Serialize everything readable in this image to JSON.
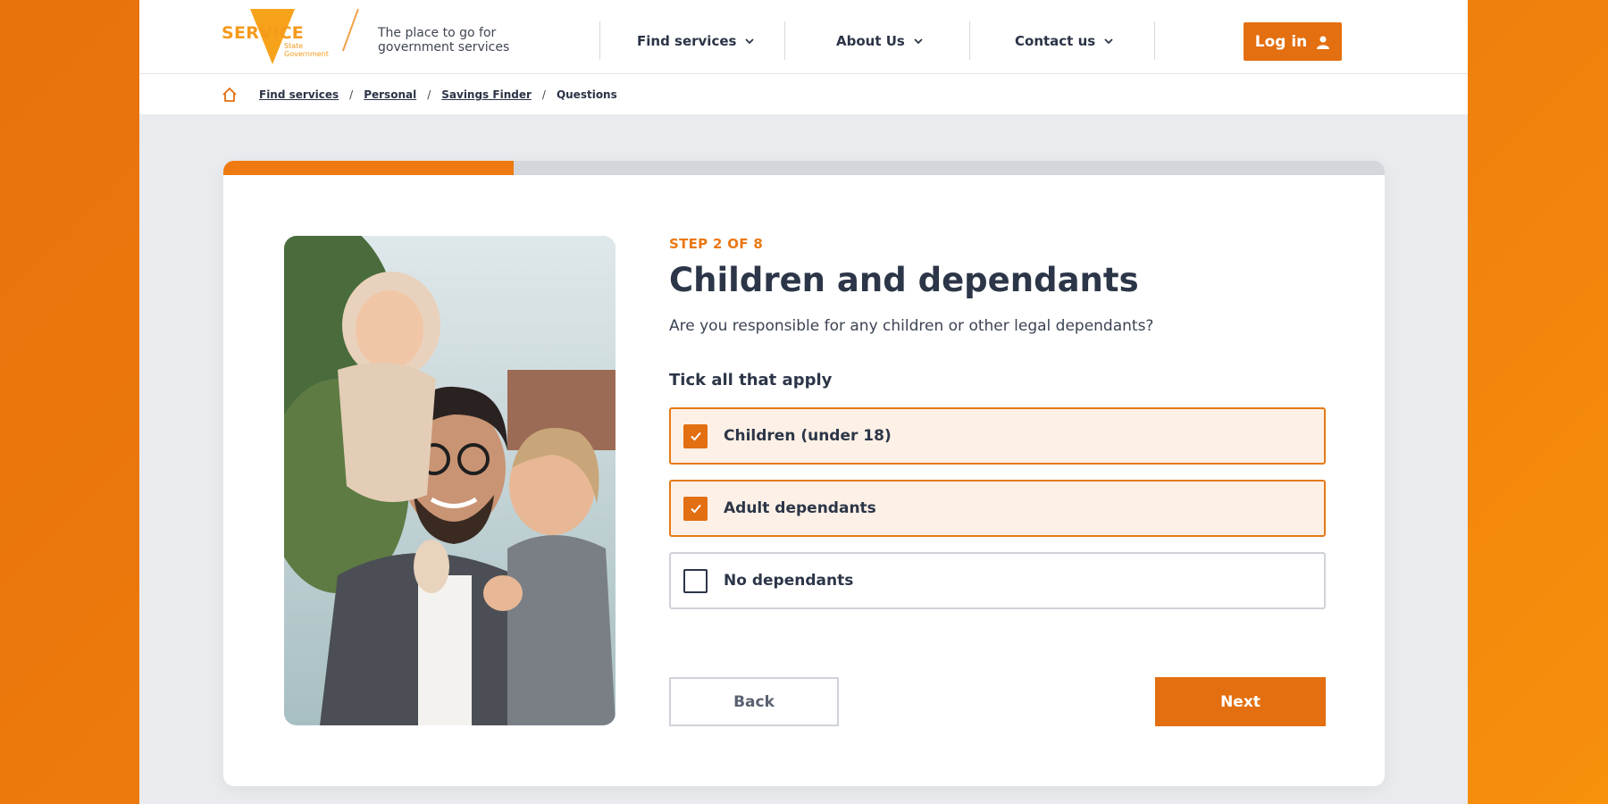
{
  "header": {
    "logo_word": "SERVICE",
    "logo_sub": "State Government",
    "tagline": "The place to go for government services",
    "nav": [
      {
        "label": "Find services"
      },
      {
        "label": "About Us"
      },
      {
        "label": "Contact us"
      }
    ],
    "login_label": "Log in"
  },
  "breadcrumb": {
    "items": [
      "Find services",
      "Personal",
      "Savings Finder"
    ],
    "current": "Questions",
    "separator": "/"
  },
  "progress": {
    "fraction": 0.25
  },
  "form": {
    "step": "STEP 2 OF 8",
    "title": "Children and dependants",
    "question": "Are you responsible for any children or other legal dependants?",
    "instruction": "Tick all that apply",
    "options": [
      {
        "label": "Children (under 18)",
        "checked": true
      },
      {
        "label": "Adult dependants",
        "checked": true
      },
      {
        "label": "No dependants",
        "checked": false
      }
    ],
    "back_label": "Back",
    "next_label": "Next"
  },
  "colors": {
    "accent": "#e36f10",
    "text": "#2c3648"
  }
}
